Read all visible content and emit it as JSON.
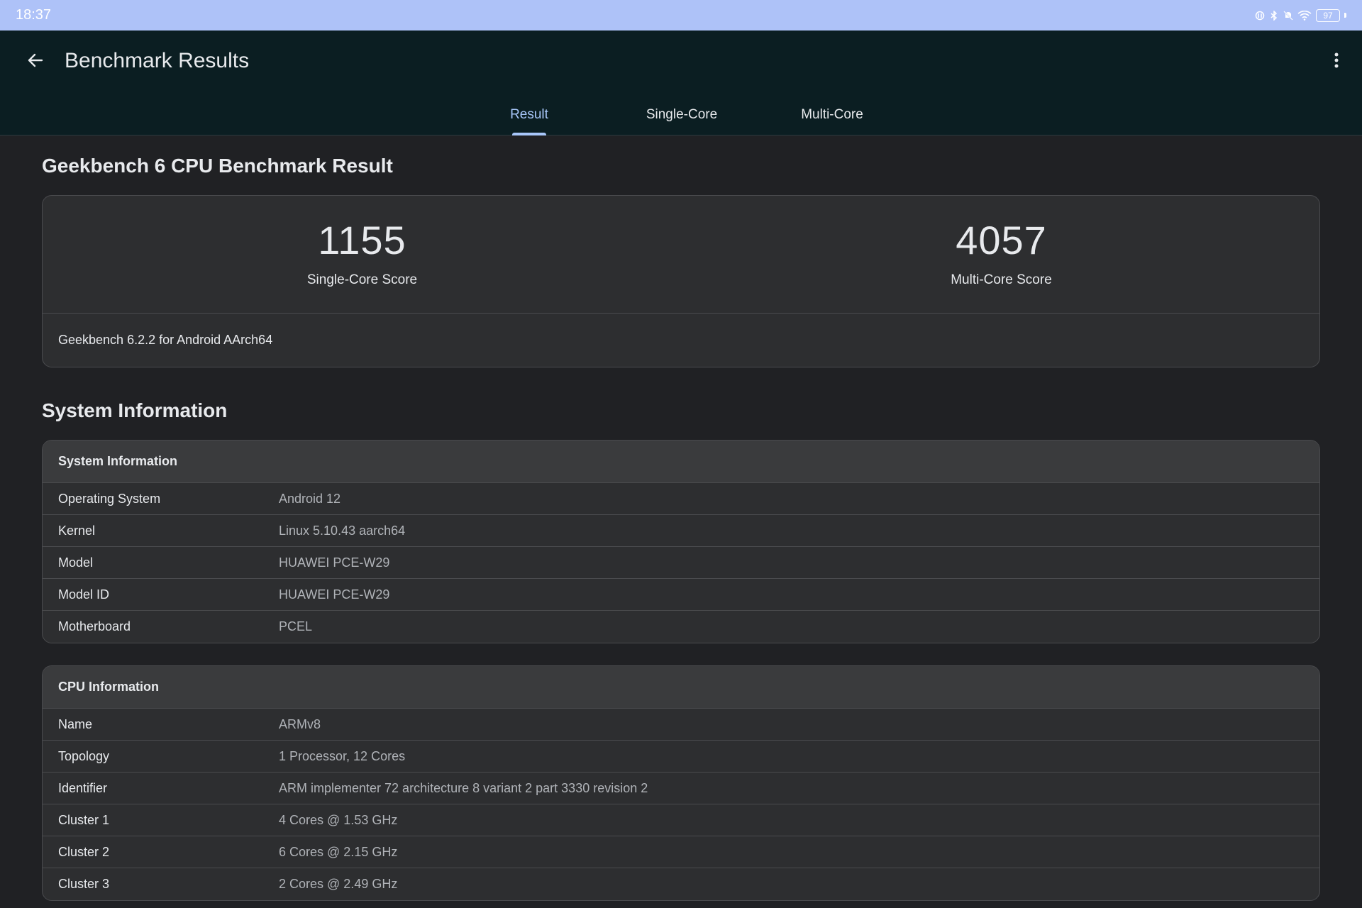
{
  "status_bar": {
    "time": "18:37",
    "battery": "97",
    "icons": [
      "nfc-icon",
      "bluetooth-icon",
      "mute-icon",
      "wifi-icon",
      "battery-icon"
    ]
  },
  "app_bar": {
    "title": "Benchmark Results",
    "tabs": [
      {
        "label": "Result",
        "active": true
      },
      {
        "label": "Single-Core",
        "active": false
      },
      {
        "label": "Multi-Core",
        "active": false
      }
    ]
  },
  "benchmark": {
    "title": "Geekbench 6 CPU Benchmark Result",
    "single_core_score": "1155",
    "single_core_label": "Single-Core Score",
    "multi_core_score": "4057",
    "multi_core_label": "Multi-Core Score",
    "version": "Geekbench 6.2.2 for Android AArch64"
  },
  "system_information": {
    "section_title": "System Information",
    "card_title": "System Information",
    "rows": [
      {
        "key": "Operating System",
        "value": "Android 12"
      },
      {
        "key": "Kernel",
        "value": "Linux 5.10.43 aarch64"
      },
      {
        "key": "Model",
        "value": "HUAWEI PCE-W29"
      },
      {
        "key": "Model ID",
        "value": "HUAWEI PCE-W29"
      },
      {
        "key": "Motherboard",
        "value": "PCEL"
      }
    ]
  },
  "cpu_information": {
    "card_title": "CPU Information",
    "rows": [
      {
        "key": "Name",
        "value": "ARMv8"
      },
      {
        "key": "Topology",
        "value": "1 Processor, 12 Cores"
      },
      {
        "key": "Identifier",
        "value": "ARM implementer 72 architecture 8 variant 2 part 3330 revision 2"
      },
      {
        "key": "Cluster 1",
        "value": "4 Cores @ 1.53 GHz"
      },
      {
        "key": "Cluster 2",
        "value": "6 Cores @ 2.15 GHz"
      },
      {
        "key": "Cluster 3",
        "value": "2 Cores @ 2.49 GHz"
      }
    ]
  },
  "colors": {
    "accent": "#a8c7fa",
    "status_bar": "#aec2f8",
    "app_bar": "#0b1e22",
    "background": "#202124",
    "card": "#2d2e30"
  }
}
